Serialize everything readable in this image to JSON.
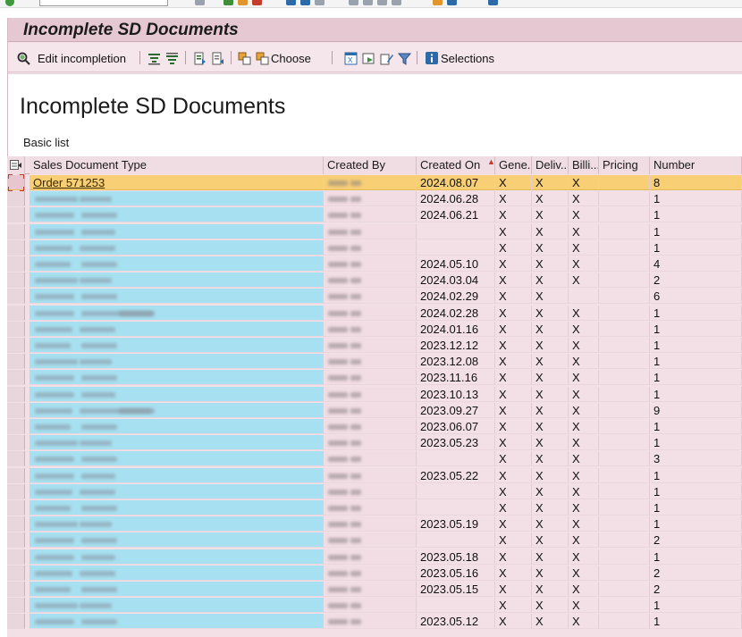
{
  "title": "Incomplete SD Documents",
  "toolbar": {
    "edit_label": "Edit incompletion",
    "choose_label": "Choose",
    "selections_label": "Selections"
  },
  "header": {
    "heading": "Incomplete SD Documents",
    "subheading": "Basic list"
  },
  "columns": [
    "Sales Document Type",
    "Created By",
    "Created On",
    "Gene...",
    "Deliv...",
    "Billi...",
    "Pricing",
    "Number"
  ],
  "rows": [
    {
      "type": "Order 571253",
      "created_on": "2024.08.07",
      "gen": "X",
      "deliv": "X",
      "billing": "X",
      "pricing": "",
      "number": "8",
      "selected": true
    },
    {
      "type": "",
      "created_on": "2024.06.28",
      "gen": "X",
      "deliv": "X",
      "billing": "X",
      "pricing": "",
      "number": "1"
    },
    {
      "type": "",
      "created_on": "2024.06.21",
      "gen": "X",
      "deliv": "X",
      "billing": "X",
      "pricing": "",
      "number": "1"
    },
    {
      "type": "",
      "created_on": "",
      "gen": "X",
      "deliv": "X",
      "billing": "X",
      "pricing": "",
      "number": "1"
    },
    {
      "type": "",
      "created_on": "",
      "gen": "X",
      "deliv": "X",
      "billing": "X",
      "pricing": "",
      "number": "1"
    },
    {
      "type": "",
      "created_on": "2024.05.10",
      "gen": "X",
      "deliv": "X",
      "billing": "X",
      "pricing": "",
      "number": "4"
    },
    {
      "type": "",
      "created_on": "2024.03.04",
      "gen": "X",
      "deliv": "X",
      "billing": "X",
      "pricing": "",
      "number": "2"
    },
    {
      "type": "",
      "created_on": "2024.02.29",
      "gen": "X",
      "deliv": "X",
      "billing": "",
      "pricing": "",
      "number": "6"
    },
    {
      "type": "",
      "created_on": "2024.02.28",
      "gen": "X",
      "deliv": "X",
      "billing": "X",
      "pricing": "",
      "number": "1"
    },
    {
      "type": "",
      "created_on": "2024.01.16",
      "gen": "X",
      "deliv": "X",
      "billing": "X",
      "pricing": "",
      "number": "1"
    },
    {
      "type": "",
      "created_on": "2023.12.12",
      "gen": "X",
      "deliv": "X",
      "billing": "X",
      "pricing": "",
      "number": "1"
    },
    {
      "type": "",
      "created_on": "2023.12.08",
      "gen": "X",
      "deliv": "X",
      "billing": "X",
      "pricing": "",
      "number": "1"
    },
    {
      "type": "",
      "created_on": "2023.11.16",
      "gen": "X",
      "deliv": "X",
      "billing": "X",
      "pricing": "",
      "number": "1"
    },
    {
      "type": "",
      "created_on": "2023.10.13",
      "gen": "X",
      "deliv": "X",
      "billing": "X",
      "pricing": "",
      "number": "1"
    },
    {
      "type": "",
      "created_on": "2023.09.27",
      "gen": "X",
      "deliv": "X",
      "billing": "X",
      "pricing": "",
      "number": "9"
    },
    {
      "type": "",
      "created_on": "2023.06.07",
      "gen": "X",
      "deliv": "X",
      "billing": "X",
      "pricing": "",
      "number": "1"
    },
    {
      "type": "",
      "created_on": "2023.05.23",
      "gen": "X",
      "deliv": "X",
      "billing": "X",
      "pricing": "",
      "number": "1"
    },
    {
      "type": "",
      "created_on": "",
      "gen": "X",
      "deliv": "X",
      "billing": "X",
      "pricing": "",
      "number": "3"
    },
    {
      "type": "",
      "created_on": "2023.05.22",
      "gen": "X",
      "deliv": "X",
      "billing": "X",
      "pricing": "",
      "number": "1"
    },
    {
      "type": "",
      "created_on": "",
      "gen": "X",
      "deliv": "X",
      "billing": "X",
      "pricing": "",
      "number": "1"
    },
    {
      "type": "",
      "created_on": "",
      "gen": "X",
      "deliv": "X",
      "billing": "X",
      "pricing": "",
      "number": "1"
    },
    {
      "type": "",
      "created_on": "2023.05.19",
      "gen": "X",
      "deliv": "X",
      "billing": "X",
      "pricing": "",
      "number": "1"
    },
    {
      "type": "",
      "created_on": "",
      "gen": "X",
      "deliv": "X",
      "billing": "X",
      "pricing": "",
      "number": "2"
    },
    {
      "type": "",
      "created_on": "2023.05.18",
      "gen": "X",
      "deliv": "X",
      "billing": "X",
      "pricing": "",
      "number": "1"
    },
    {
      "type": "",
      "created_on": "2023.05.16",
      "gen": "X",
      "deliv": "X",
      "billing": "X",
      "pricing": "",
      "number": "2"
    },
    {
      "type": "",
      "created_on": "2023.05.15",
      "gen": "X",
      "deliv": "X",
      "billing": "X",
      "pricing": "",
      "number": "2"
    },
    {
      "type": "",
      "created_on": "",
      "gen": "X",
      "deliv": "X",
      "billing": "X",
      "pricing": "",
      "number": "1"
    },
    {
      "type": "",
      "created_on": "2023.05.12",
      "gen": "X",
      "deliv": "X",
      "billing": "X",
      "pricing": "",
      "number": "1"
    }
  ],
  "colors": {
    "title_bg": "#e6c8d2",
    "grid_bg": "#f2e0e6",
    "type_col_bg": "#a7e1f1",
    "selected_row_bg": "#f8cf74"
  },
  "icons": [
    "ok-check-icon",
    "edit-incompletion-icon",
    "sort-ascending-icon",
    "sort-descending-icon",
    "export-icon",
    "import-icon",
    "choose-icon",
    "excel-icon",
    "print-icon",
    "edit-icon",
    "filter-icon",
    "info-icon",
    "column-settings-icon"
  ]
}
